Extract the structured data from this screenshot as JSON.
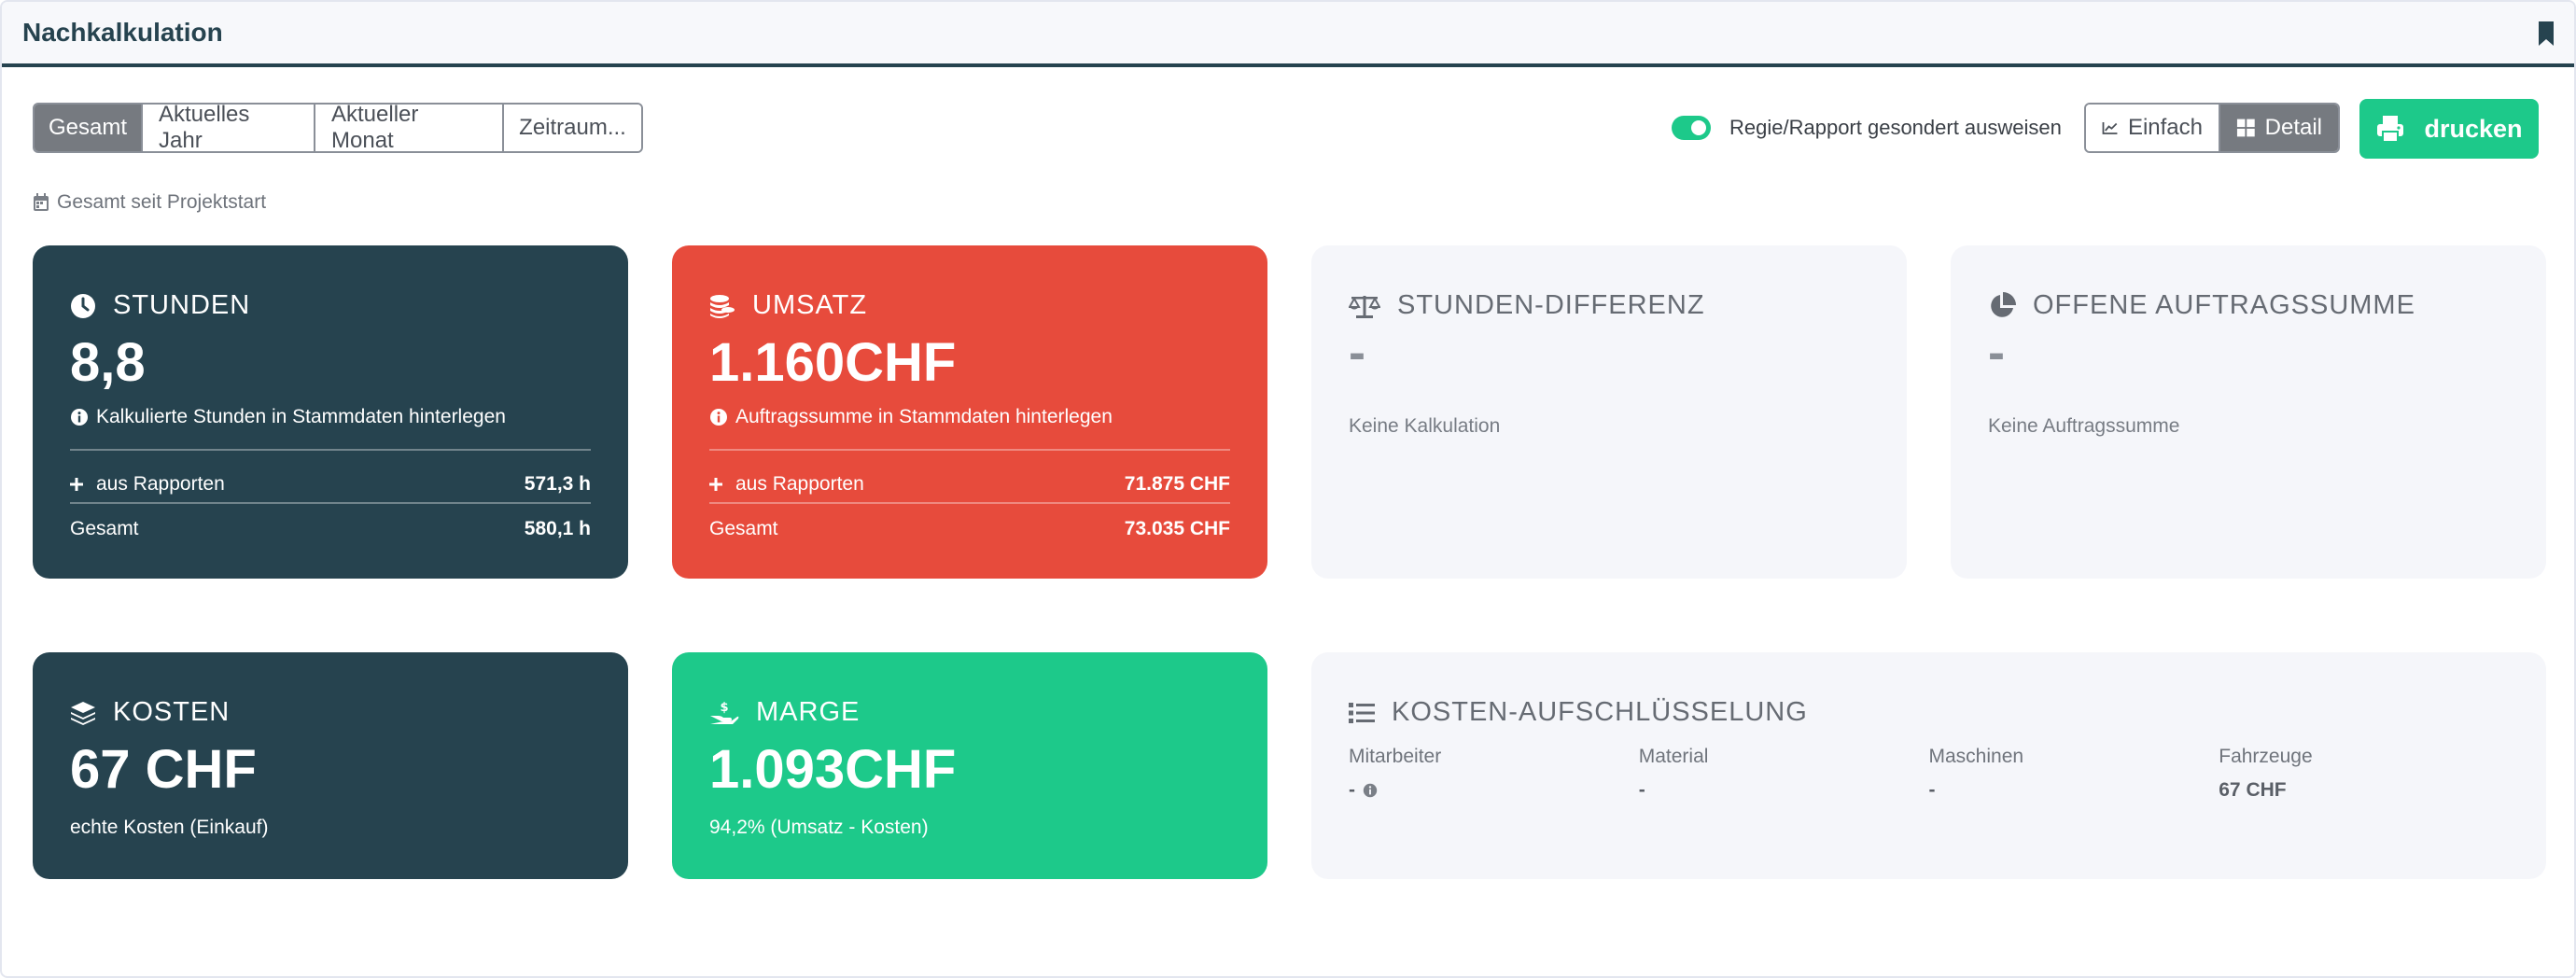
{
  "header": {
    "title": "Nachkalkulation",
    "bookmark_icon": "bookmark-icon"
  },
  "period_tabs": [
    "Gesamt",
    "Aktuelles Jahr",
    "Aktueller Monat",
    "Zeitraum..."
  ],
  "active_period": "Gesamt",
  "toggle": {
    "label": "Regie/Rapport gesondert ausweisen",
    "on": true
  },
  "view_mode": {
    "einfach": "Einfach",
    "detail": "Detail",
    "active": "Detail"
  },
  "print_button": "drucken",
  "period_note": "Gesamt seit Projektstart",
  "colors": {
    "dark": "#26434f",
    "red": "#e74b3c",
    "green": "#1dc98a",
    "light": "#f5f6fa"
  },
  "cards": {
    "stunden": {
      "title": "STUNDEN",
      "value": "8,8",
      "hint": "Kalkulierte Stunden in Stammdaten hinterlegen",
      "row1_label": "aus Rapporten",
      "row1_value": "571,3 h",
      "row2_label": "Gesamt",
      "row2_value": "580,1 h"
    },
    "umsatz": {
      "title": "UMSATZ",
      "value": "1.160CHF",
      "hint": "Auftragssumme in Stammdaten hinterlegen",
      "row1_label": "aus Rapporten",
      "row1_value": "71.875 CHF",
      "row2_label": "Gesamt",
      "row2_value": "73.035 CHF"
    },
    "stunden_differenz": {
      "title": "STUNDEN-DIFFERENZ",
      "value": "-",
      "sub": "Keine Kalkulation"
    },
    "offene_auftragssumme": {
      "title": "OFFENE AUFTRAGSSUMME",
      "value": "-",
      "sub": "Keine Auftragssumme"
    },
    "kosten": {
      "title": "KOSTEN",
      "value": "67 CHF",
      "sub": "echte Kosten (Einkauf)"
    },
    "marge": {
      "title": "MARGE",
      "value": "1.093CHF",
      "sub": "94,2% (Umsatz - Kosten)"
    },
    "kosten_aufschluesselung": {
      "title": "KOSTEN-AUFSCHLÜSSELUNG",
      "columns": [
        {
          "label": "Mitarbeiter",
          "value": "-"
        },
        {
          "label": "Material",
          "value": "-"
        },
        {
          "label": "Maschinen",
          "value": "-"
        },
        {
          "label": "Fahrzeuge",
          "value": "67 CHF"
        }
      ]
    }
  }
}
